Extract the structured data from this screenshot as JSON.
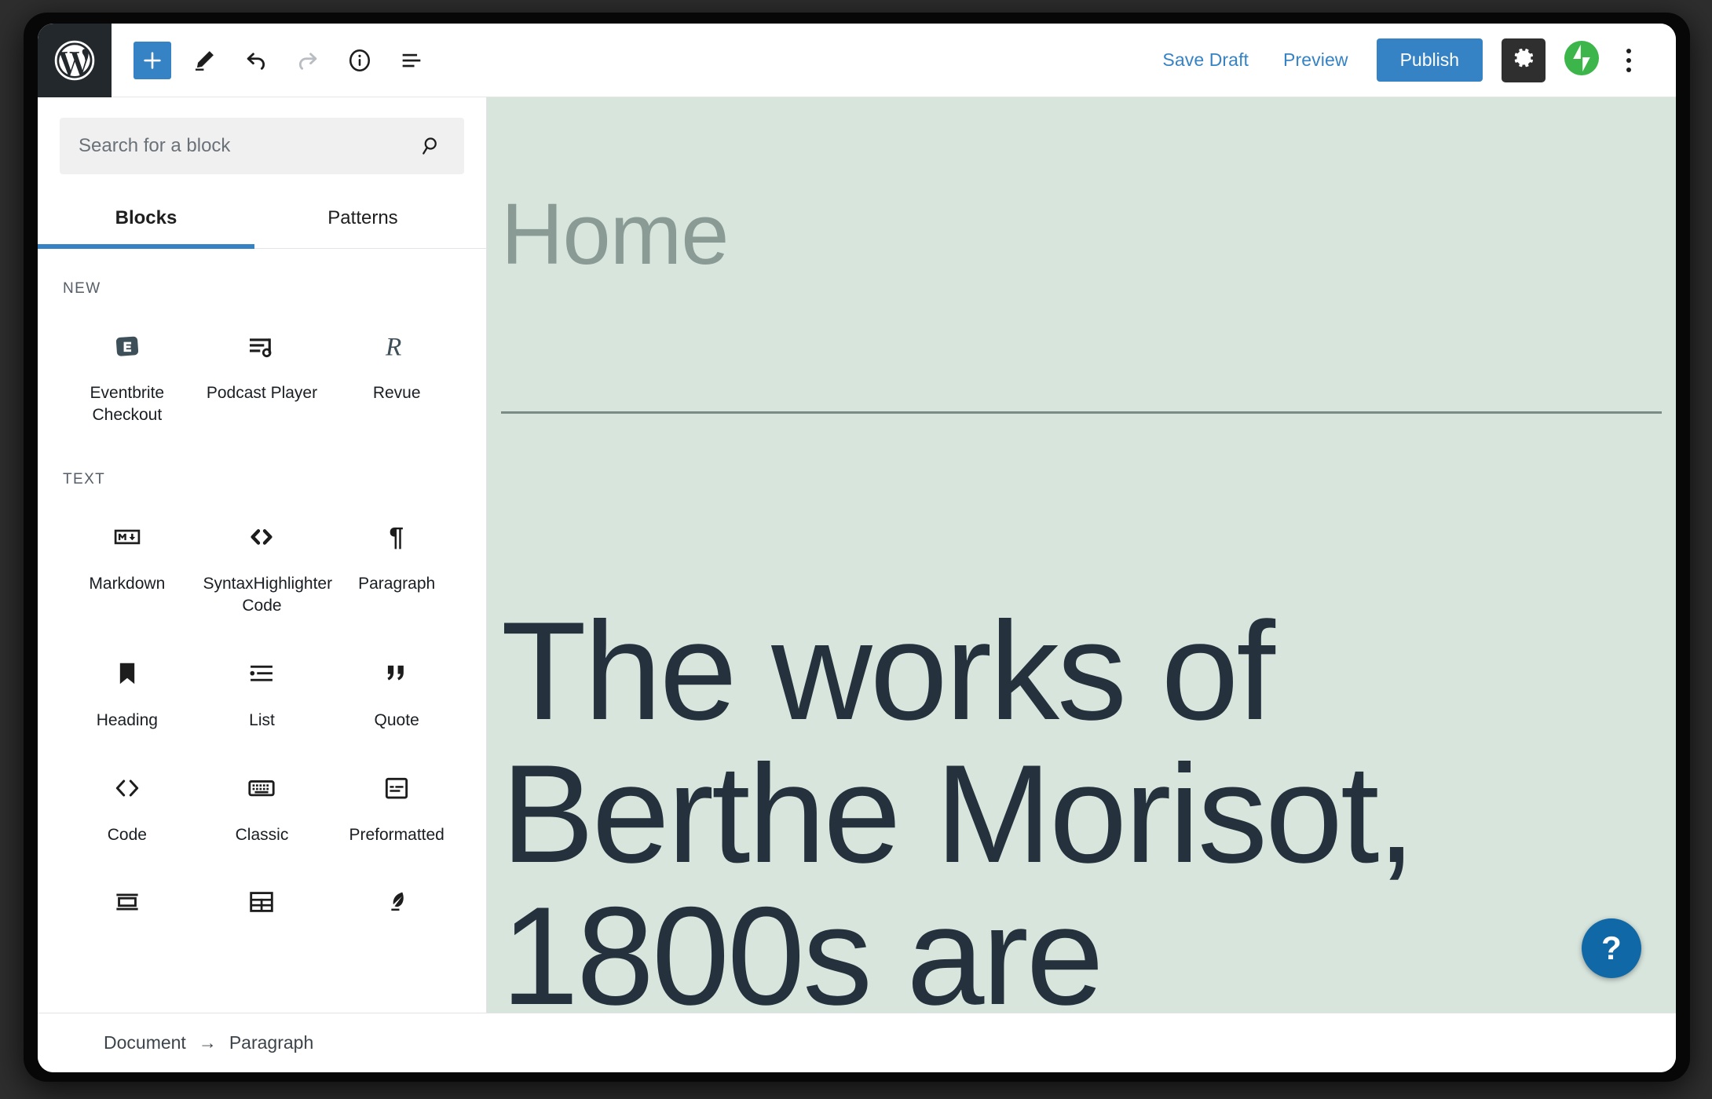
{
  "window": {
    "app_name": "WordPress Block Editor"
  },
  "toolbar": {
    "logo_icon": "wordpress-logo-icon",
    "add_block_icon": "plus-icon",
    "edit_icon": "pencil-icon",
    "undo_icon": "undo-arrow-icon",
    "redo_icon": "redo-arrow-icon",
    "info_icon": "info-circle-icon",
    "block_navigation_icon": "block-navigation-icon",
    "save_draft_label": "Save Draft",
    "preview_label": "Preview",
    "publish_label": "Publish",
    "settings_icon": "gear-icon",
    "jetpack_icon": "jetpack-icon",
    "more_options_icon": "three-dots-vertical-icon",
    "accent_color": "#3582c4",
    "jetpack_color": "#3cb54a",
    "logo_tile_color": "#23282d"
  },
  "inserter": {
    "search": {
      "placeholder": "Search for a block",
      "value": "",
      "icon": "search-icon"
    },
    "tabs": [
      {
        "label": "Blocks",
        "active": true
      },
      {
        "label": "Patterns",
        "active": false
      }
    ],
    "categories": [
      {
        "title": "NEW",
        "blocks": [
          {
            "label": "Eventbrite Checkout",
            "icon": "eventbrite-icon"
          },
          {
            "label": "Podcast Player",
            "icon": "podcast-player-icon"
          },
          {
            "label": "Revue",
            "icon": "revue-icon"
          }
        ]
      },
      {
        "title": "TEXT",
        "blocks": [
          {
            "label": "Markdown",
            "icon": "markdown-icon"
          },
          {
            "label": "SyntaxHighlighter Code",
            "icon": "code-brackets-icon"
          },
          {
            "label": "Paragraph",
            "icon": "pilcrow-icon"
          },
          {
            "label": "Heading",
            "icon": "bookmark-icon"
          },
          {
            "label": "List",
            "icon": "list-icon"
          },
          {
            "label": "Quote",
            "icon": "quote-icon"
          },
          {
            "label": "Code",
            "icon": "angle-brackets-icon"
          },
          {
            "label": "Classic",
            "icon": "keyboard-icon"
          },
          {
            "label": "Preformatted",
            "icon": "preformatted-icon"
          },
          {
            "label": "",
            "icon": "pullquote-icon"
          },
          {
            "label": "",
            "icon": "table-icon"
          },
          {
            "label": "",
            "icon": "verse-feather-icon"
          }
        ]
      }
    ]
  },
  "canvas": {
    "post_title": "Home",
    "post_body": "The works of Berthe Morisot, 1800s are",
    "background_color": "#d7e5dd",
    "text_color": "#25313c",
    "title_color": "#8a9a94",
    "help_button_label": "?"
  },
  "statusbar": {
    "breadcrumb": [
      "Document",
      "Paragraph"
    ],
    "separator": "→"
  }
}
